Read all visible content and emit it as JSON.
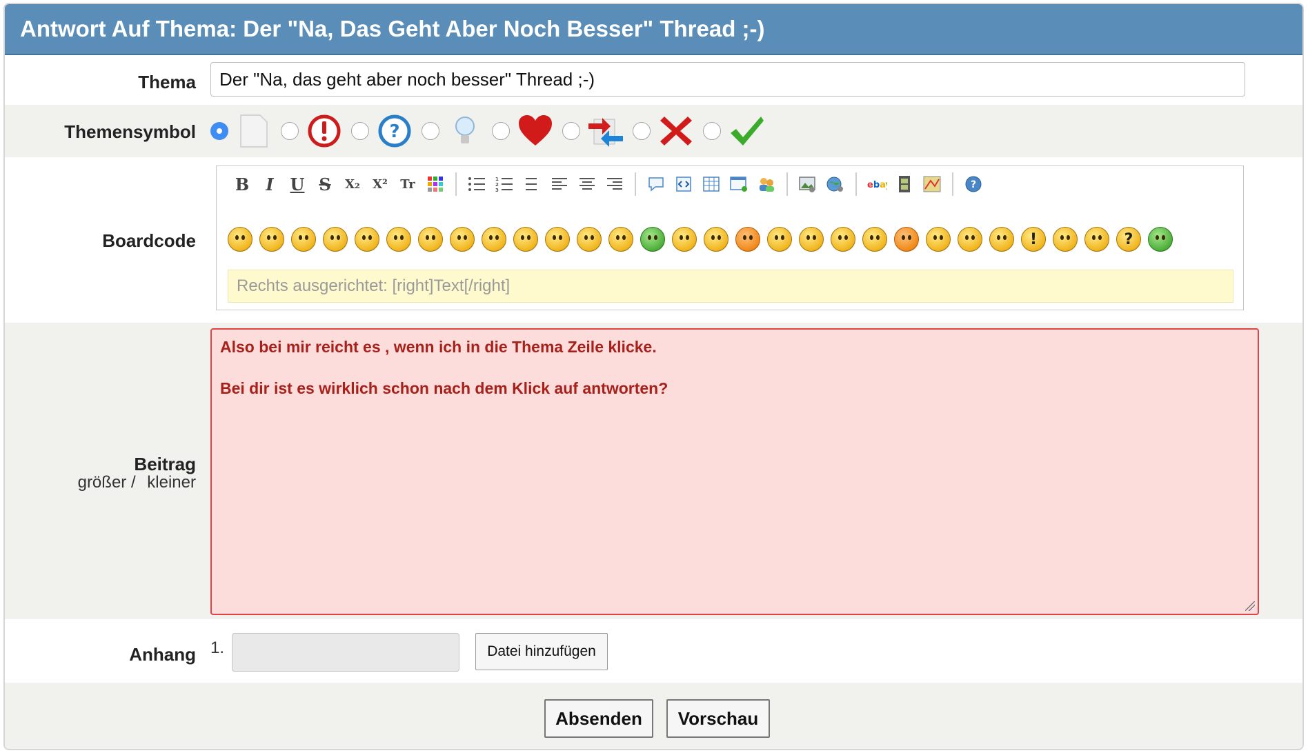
{
  "header": {
    "title": "Antwort Auf Thema: Der \"Na, Das Geht Aber Noch Besser\" Thread ;-)"
  },
  "subject": {
    "label": "Thema",
    "value": "Der \"Na, das geht aber noch besser\" Thread ;-)"
  },
  "topic_icons": {
    "label": "Themensymbol",
    "selected_index": 0,
    "icons": [
      "blank-page-icon",
      "exclamation-icon",
      "question-icon",
      "lightbulb-icon",
      "heart-icon",
      "arrows-icon",
      "red-x-icon",
      "green-check-icon"
    ]
  },
  "boardcode": {
    "label": "Boardcode",
    "toolbar": {
      "bold": "B",
      "italic": "I",
      "underline": "U",
      "strike": "S",
      "subscript": "X₂",
      "superscript": "X²",
      "font_size": "Tr"
    },
    "hint_text": "Rechts ausgerichtet: [right]Text[/right]",
    "smilies_count": 30
  },
  "post": {
    "label": "Beitrag",
    "bigger": "größer /",
    "smaller": "kleiner",
    "line1": "Also bei mir reicht es , wenn ich in die Thema Zeile klicke.",
    "line2": "Bei dir ist es wirklich schon nach dem Klick auf antworten?"
  },
  "attachment": {
    "label": "Anhang",
    "number": "1.",
    "add_button": "Datei hinzufügen"
  },
  "actions": {
    "submit": "Absenden",
    "preview": "Vorschau"
  },
  "colors": {
    "header": "#5a8db8",
    "error_bg": "#fddcdc",
    "error_text": "#a8201a",
    "hint_bg": "#fffacd"
  }
}
